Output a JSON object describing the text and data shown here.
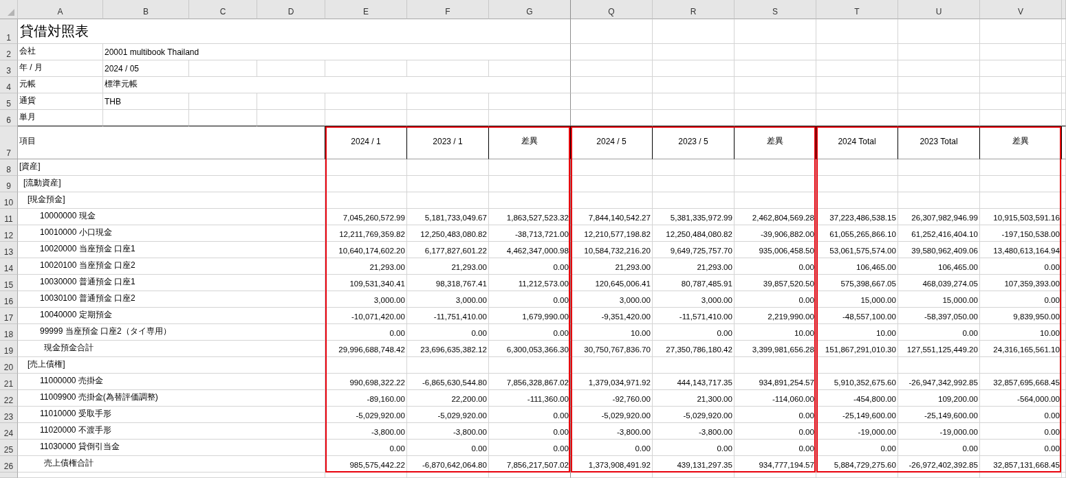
{
  "sheet": {
    "column_headers": [
      "A",
      "B",
      "C",
      "D",
      "E",
      "F",
      "G",
      "Q",
      "R",
      "S",
      "T",
      "U",
      "V"
    ],
    "row_headers": [
      "1",
      "2",
      "3",
      "4",
      "5",
      "6",
      "7",
      "8",
      "9",
      "10",
      "11",
      "12",
      "13",
      "14",
      "15",
      "16",
      "17",
      "18",
      "19",
      "20",
      "21",
      "22",
      "23",
      "24",
      "25",
      "26"
    ],
    "title": "貸借対照表",
    "info": [
      {
        "label": "会社",
        "value": "20001 multibook Thailand",
        "merged": true
      },
      {
        "label": "年 / 月",
        "value": "2024 / 05",
        "merged": false
      },
      {
        "label": "元帳",
        "value": "標準元帳",
        "merged": true
      },
      {
        "label": "通貨",
        "value": "THB",
        "merged": false
      },
      {
        "label": "単月",
        "merged": false
      }
    ],
    "item_header": "項目",
    "column_groups": [
      {
        "headers": [
          "2024 / 1",
          "2023 / 1",
          "差異"
        ],
        "highlighted": true
      },
      {
        "headers": [
          "2024 / 5",
          "2023 / 5",
          "差異"
        ],
        "highlighted": true
      },
      {
        "headers": [
          "2024 Total",
          "2023 Total",
          "差異"
        ],
        "highlighted": true
      }
    ],
    "rows": [
      {
        "label": "[資産]",
        "kind": "group",
        "children": [
          {
            "label": "[流動資産]",
            "kind": "group",
            "children": [
              {
                "label": "[現金預金]",
                "kind": "group",
                "children": [
                  {
                    "label": "10000000 現金",
                    "kind": "account",
                    "values": [
                      "7,045,260,572.99",
                      "5,181,733,049.67",
                      "1,863,527,523.32",
                      "7,844,140,542.27",
                      "5,381,335,972.99",
                      "2,462,804,569.28",
                      "37,223,486,538.15",
                      "26,307,982,946.99",
                      "10,915,503,591.16"
                    ]
                  },
                  {
                    "label": "10010000 小口現金",
                    "kind": "account",
                    "values": [
                      "12,211,769,359.82",
                      "12,250,483,080.82",
                      "-38,713,721.00",
                      "12,210,577,198.82",
                      "12,250,484,080.82",
                      "-39,906,882.00",
                      "61,055,265,866.10",
                      "61,252,416,404.10",
                      "-197,150,538.00"
                    ]
                  },
                  {
                    "label": "10020000 当座預金 口座1",
                    "kind": "account",
                    "values": [
                      "10,640,174,602.20",
                      "6,177,827,601.22",
                      "4,462,347,000.98",
                      "10,584,732,216.20",
                      "9,649,725,757.70",
                      "935,006,458.50",
                      "53,061,575,574.00",
                      "39,580,962,409.06",
                      "13,480,613,164.94"
                    ]
                  },
                  {
                    "label": "10020100 当座預金 口座2",
                    "kind": "account",
                    "values": [
                      "21,293.00",
                      "21,293.00",
                      "0.00",
                      "21,293.00",
                      "21,293.00",
                      "0.00",
                      "106,465.00",
                      "106,465.00",
                      "0.00"
                    ]
                  },
                  {
                    "label": "10030000 普通預金 口座1",
                    "kind": "account",
                    "values": [
                      "109,531,340.41",
                      "98,318,767.41",
                      "11,212,573.00",
                      "120,645,006.41",
                      "80,787,485.91",
                      "39,857,520.50",
                      "575,398,667.05",
                      "468,039,274.05",
                      "107,359,393.00"
                    ]
                  },
                  {
                    "label": "10030100 普通預金 口座2",
                    "kind": "account",
                    "values": [
                      "3,000.00",
                      "3,000.00",
                      "0.00",
                      "3,000.00",
                      "3,000.00",
                      "0.00",
                      "15,000.00",
                      "15,000.00",
                      "0.00"
                    ]
                  },
                  {
                    "label": "10040000 定期預金",
                    "kind": "account",
                    "values": [
                      "-10,071,420.00",
                      "-11,751,410.00",
                      "1,679,990.00",
                      "-9,351,420.00",
                      "-11,571,410.00",
                      "2,219,990.00",
                      "-48,557,100.00",
                      "-58,397,050.00",
                      "9,839,950.00"
                    ]
                  },
                  {
                    "label": "99999 当座預金 口座2（タイ専用）",
                    "kind": "account",
                    "values": [
                      "0.00",
                      "0.00",
                      "0.00",
                      "10.00",
                      "0.00",
                      "10.00",
                      "10.00",
                      "0.00",
                      "10.00"
                    ]
                  },
                  {
                    "label": "現金預金合計",
                    "kind": "total",
                    "values": [
                      "29,996,688,748.42",
                      "23,696,635,382.12",
                      "6,300,053,366.30",
                      "30,750,767,836.70",
                      "27,350,786,180.42",
                      "3,399,981,656.28",
                      "151,867,291,010.30",
                      "127,551,125,449.20",
                      "24,316,165,561.10"
                    ]
                  }
                ]
              },
              {
                "label": "[売上債権]",
                "kind": "group",
                "children": [
                  {
                    "label": "11000000 売掛金",
                    "kind": "account",
                    "values": [
                      "990,698,322.22",
                      "-6,865,630,544.80",
                      "7,856,328,867.02",
                      "1,379,034,971.92",
                      "444,143,717.35",
                      "934,891,254.57",
                      "5,910,352,675.60",
                      "-26,947,342,992.85",
                      "32,857,695,668.45"
                    ]
                  },
                  {
                    "label": "11009900 売掛金(為替評価調整)",
                    "kind": "account",
                    "values": [
                      "-89,160.00",
                      "22,200.00",
                      "-111,360.00",
                      "-92,760.00",
                      "21,300.00",
                      "-114,060.00",
                      "-454,800.00",
                      "109,200.00",
                      "-564,000.00"
                    ]
                  },
                  {
                    "label": "11010000 受取手形",
                    "kind": "account",
                    "values": [
                      "-5,029,920.00",
                      "-5,029,920.00",
                      "0.00",
                      "-5,029,920.00",
                      "-5,029,920.00",
                      "0.00",
                      "-25,149,600.00",
                      "-25,149,600.00",
                      "0.00"
                    ]
                  },
                  {
                    "label": "11020000 不渡手形",
                    "kind": "account",
                    "values": [
                      "-3,800.00",
                      "-3,800.00",
                      "0.00",
                      "-3,800.00",
                      "-3,800.00",
                      "0.00",
                      "-19,000.00",
                      "-19,000.00",
                      "0.00"
                    ]
                  },
                  {
                    "label": "11030000 貸倒引当金",
                    "kind": "account",
                    "values": [
                      "0.00",
                      "0.00",
                      "0.00",
                      "0.00",
                      "0.00",
                      "0.00",
                      "0.00",
                      "0.00",
                      "0.00"
                    ]
                  },
                  {
                    "label": "売上債権合計",
                    "kind": "total",
                    "values": [
                      "985,575,442.22",
                      "-6,870,642,064.80",
                      "7,856,217,507.02",
                      "1,373,908,491.92",
                      "439,131,297.35",
                      "934,777,194.57",
                      "5,884,729,275.60",
                      "-26,972,402,392.85",
                      "32,857,131,668.45"
                    ]
                  }
                ]
              }
            ]
          }
        ]
      }
    ]
  }
}
